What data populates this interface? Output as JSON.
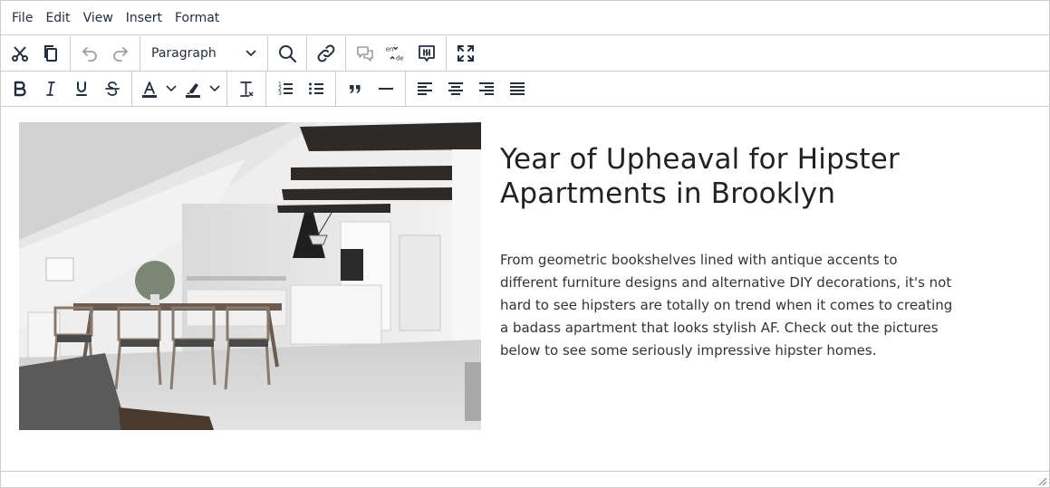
{
  "menubar": {
    "items": [
      "File",
      "Edit",
      "View",
      "Insert",
      "Format"
    ]
  },
  "toolbar": {
    "block_format": "Paragraph",
    "language_from": "en",
    "language_to": "de",
    "icons_row1": [
      "cut-icon",
      "copy-icon",
      "undo-icon",
      "redo-icon",
      "search-replace-icon",
      "link-icon",
      "comments-icon",
      "language-icon",
      "accessibility-checker-icon",
      "fullscreen-icon"
    ],
    "icons_row2": [
      "bold-icon",
      "italic-icon",
      "underline-icon",
      "strikethrough-icon",
      "text-color-icon",
      "highlight-color-icon",
      "remove-format-icon",
      "numbered-list-icon",
      "bullet-list-icon",
      "blockquote-icon",
      "horizontal-rule-icon",
      "align-left-icon",
      "align-center-icon",
      "align-right-icon",
      "align-justify-icon"
    ]
  },
  "document": {
    "heading": "Year of Upheaval for Hipster Apartments in Brooklyn",
    "paragraph": "From geometric bookshelves lined with antique accents to different furniture designs and alternative DIY decorations, it's not hard to see hipsters are totally on trend when it comes to creating a badass apartment that looks stylish AF. Check out the pictures below to see some seriously impressive hipster homes."
  },
  "colors": {
    "border": "#cccccc",
    "icon": "#222f3e",
    "text": "#333333",
    "heading": "#222222"
  }
}
